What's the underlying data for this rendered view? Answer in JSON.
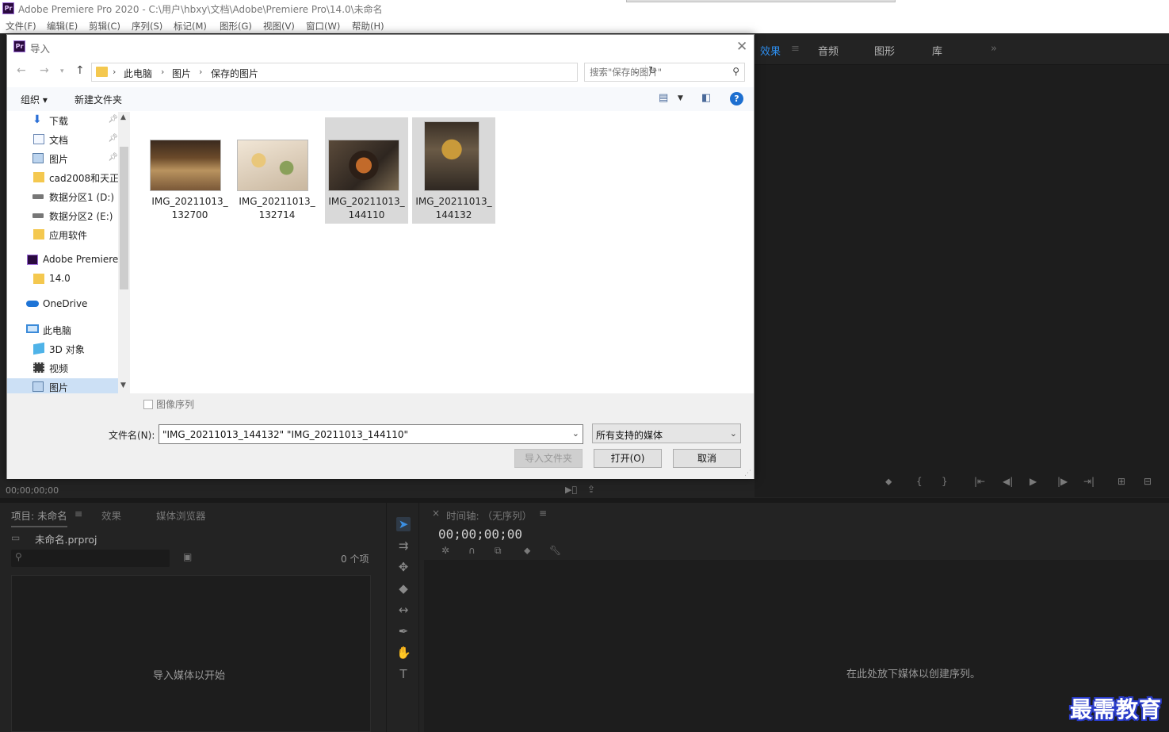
{
  "app": {
    "title": "Adobe Premiere Pro 2020 - C:\\用户\\hbxy\\文档\\Adobe\\Premiere Pro\\14.0\\未命名",
    "logo": "Pr"
  },
  "menu": [
    "文件(F)",
    "编辑(E)",
    "剪辑(C)",
    "序列(S)",
    "标记(M)",
    "图形(G)",
    "视图(V)",
    "窗口(W)",
    "帮助(H)"
  ],
  "right_tabs": [
    "效果",
    "音频",
    "图形",
    "库"
  ],
  "right_tabs_more": "»",
  "source": {
    "timecode": "00;00;00;00"
  },
  "project": {
    "tabs": [
      "项目: 未命名",
      "效果",
      "媒体浏览器"
    ],
    "file": "未命名.prproj",
    "count": "0 个项",
    "hint": "导入媒体以开始"
  },
  "timeline": {
    "title": "时间轴: （无序列）",
    "timecode": "00;00;00;00",
    "hint": "在此处放下媒体以创建序列。"
  },
  "watermark": "最需教育",
  "dialog": {
    "title": "导入",
    "breadcrumb": [
      "此电脑",
      "图片",
      "保存的图片"
    ],
    "search_placeholder": "搜索\"保存的图片\"",
    "organize": "组织 ▾",
    "new_folder": "新建文件夹",
    "help": "?",
    "nav": [
      {
        "label": "下载",
        "icon": "download-icon",
        "pinned": true
      },
      {
        "label": "文档",
        "icon": "document-icon",
        "pinned": true
      },
      {
        "label": "图片",
        "icon": "pictures-icon",
        "pinned": true
      },
      {
        "label": "cad2008和天正",
        "icon": "folder-icon",
        "pinned": false
      },
      {
        "label": "数据分区1 (D:)",
        "icon": "drive-icon",
        "pinned": false
      },
      {
        "label": "数据分区2 (E:)",
        "icon": "drive-icon",
        "pinned": false
      },
      {
        "label": "应用软件",
        "icon": "folder-icon",
        "pinned": false
      },
      {
        "label": "Adobe Premiere",
        "icon": "premiere-icon",
        "pinned": false
      },
      {
        "label": "14.0",
        "icon": "folder-icon",
        "pinned": false
      },
      {
        "label": "OneDrive",
        "icon": "onedrive-icon",
        "pinned": false
      },
      {
        "label": "此电脑",
        "icon": "computer-icon",
        "pinned": false
      },
      {
        "label": "3D 对象",
        "icon": "3d-objects-icon",
        "pinned": false
      },
      {
        "label": "视频",
        "icon": "video-icon",
        "pinned": false
      },
      {
        "label": "图片",
        "icon": "pictures-icon",
        "pinned": false
      }
    ],
    "files": [
      {
        "line1": "IMG_20211013_",
        "line2": "132700",
        "selected": false
      },
      {
        "line1": "IMG_20211013_",
        "line2": "132714",
        "selected": false
      },
      {
        "line1": "IMG_20211013_",
        "line2": "144110",
        "selected": true
      },
      {
        "line1": "IMG_20211013_",
        "line2": "144132",
        "selected": true
      }
    ],
    "image_sequence": "图像序列",
    "filename_label": "文件名(N):",
    "filename_value": "\"IMG_20211013_144132\" \"IMG_20211013_144110\"",
    "filetype": "所有支持的媒体",
    "btn_import_folder": "导入文件夹",
    "btn_open": "打开(O)",
    "btn_cancel": "取消"
  },
  "colors": {
    "accent": "#2d8ceb",
    "premiere_bg": "#232323",
    "selection": "#d9d9d9"
  }
}
